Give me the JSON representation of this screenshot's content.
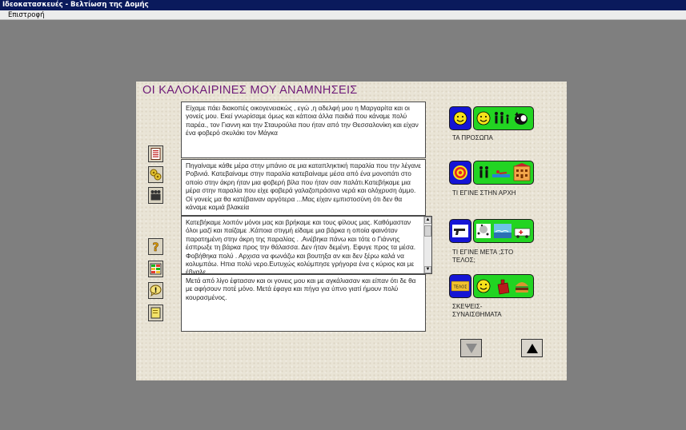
{
  "window": {
    "title": "Ιδεοκατασκευές - Βελτίωση της Δομής"
  },
  "menu": {
    "back": "Επιστροφή"
  },
  "page": {
    "title": "ΟΙ ΚΑΛΟΚΑΙΡΙΝΕΣ ΜΟΥ ΑΝΑΜΝΗΣΕΙΣ"
  },
  "text_blocks": [
    "Είχαμε πάει διακοπές οικογενειακώς , εγώ ,η αδελφή μου η Μαργαρίτα και οι γονείς μου. Εκεί γνωρίσαμε όμως και κάποια άλλα παιδιά που κάναμε πολύ παρέα., τον Γιαννη και την Σταυρούλα που ήταν από την Θεσσαλονίκη και είχαν ένα φοβερό σκυλάκι τον Μάγκα",
    "Πηγαίναμε κάθε μέρα στην μπάνιο σε μια καταπληκτική παραλία που την λέγανε Ροβινιά. Κατεβαίναμε στην παραλία κατεβαίναμε μέσα από ένα μονοπάτι στο οποίο στην άκρη ήταν μια φοβερή βίλα που ήταν σαν παλάτι.Κατεβήκαμε μια μέρα στην παραλία που είχε φοβερά γαλαζοπράσινα νερά και ολόχρυση άμμο. Οί γονείς μα θα κατέβαιναν αργότερα ...Μας είχαν εμπιστοσύνη ότι δεν θα κάναμε καμιά βλακεία",
    "Κατεβήκαμε λοιπόν μόνοι μας και βρήκαμε και τους φίλους μας. Καθόμασταν όλοι μαζί και παίζαμε .Κάποια στιγμή είδαμε μια βάρκα η οποία φαινόταν παρατημένη στην άκρη της παραλίας . .Ανέβηκα πάνω και τότε ο Γιάννης έσπρωξε τη βάρκα προς την θάλασσα. Δεν ήταν δεμένη. Εφυγε προς τα μέσα. Φοβήθηκα πολύ .    Αρχισα να φωνάζω και βουτηξα αν και δεν ξέρω καλά να κολυμπάω. Ηπια πολύ νερο.Ευτυχώς    κολύμπησε  γρήγορα ένα ς κύριος και με έβγαλε.",
    "Μετά από λίγο έφτασαν και οι γονεις μου και με αγκάλιασαν και είπαν ότι δε θα με αφήσουν ποτέ μόνο. Μετά έφαγα και πήγα για ύπνο γιατί ήμουν πολύ κουρασμένος."
  ],
  "categories": [
    {
      "label": "ΤΑ ΠΡΟΣΩΠΑ",
      "icon": "smiley-icon",
      "items": [
        "smiley-icon",
        "family-icon",
        "dog-icon"
      ]
    },
    {
      "label": "ΤΙ ΕΓΙΝΕ ΣΤΗΝ ΑΡΧΗ",
      "icon": "target-icon",
      "items": [
        "children-icon",
        "swimmer-icon",
        "villa-icon"
      ]
    },
    {
      "label": "ΤΙ ΕΓΙΝΕ ΜΕΤΑ ;ΣΤΟ ΤΕΛΟΣ;",
      "icon": "gun-icon",
      "items": [
        "beach-people-icon",
        "sea-icon",
        "ambulance-icon"
      ]
    },
    {
      "label": "ΣΚΕΨΕΙΣ-ΣΥΝΑΙΣΘΗΜΑΤΑ",
      "icon": "telos-icon",
      "items": [
        "smiley-icon",
        "bag-icon",
        "burger-icon"
      ]
    }
  ],
  "telos_badge": "ΤΕΛΟΣ",
  "colors": {
    "title": "#6e1b78",
    "blue_button": "#1515d5",
    "green_button": "#22d422",
    "panel": "#e9e4d6"
  }
}
